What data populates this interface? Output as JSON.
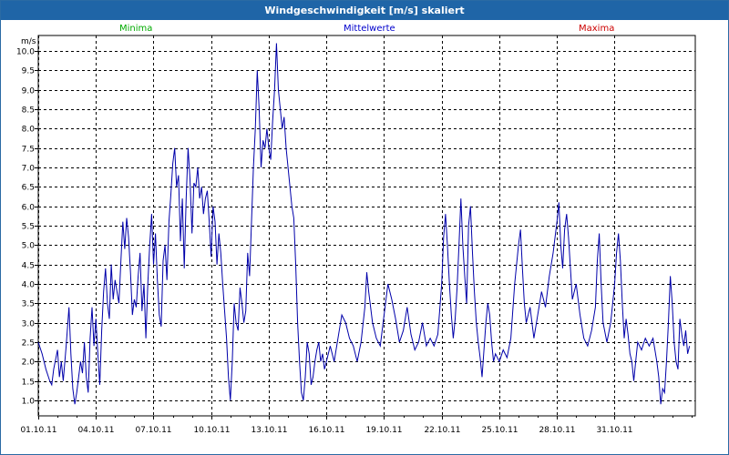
{
  "window": {
    "title": "Windgeschwindigkeit [m/s] skaliert"
  },
  "legend": [
    {
      "label": "Minima",
      "color": "#00aa00"
    },
    {
      "label": "Mittelwerte",
      "color": "#0000cc"
    },
    {
      "label": "Maxima",
      "color": "#cc0000"
    }
  ],
  "chart_data": {
    "type": "line",
    "title": "Windgeschwindigkeit [m/s] skaliert",
    "ylabel": "m/s",
    "xlabel": "",
    "ylim": [
      0.6,
      10.4
    ],
    "yticks": [
      "1.0",
      "1.5",
      "2.0",
      "2.5",
      "3.0",
      "3.5",
      "4.0",
      "4.5",
      "5.0",
      "5.5",
      "6.0",
      "6.5",
      "7.0",
      "7.5",
      "8.0",
      "8.5",
      "9.0",
      "9.5",
      "10.0"
    ],
    "xticks": [
      "01.10.11",
      "04.10.11",
      "07.10.11",
      "10.10.11",
      "13.10.11",
      "16.10.11",
      "19.10.11",
      "22.10.11",
      "25.10.11",
      "28.10.11",
      "31.10.11"
    ],
    "xrange_days": [
      0,
      34.2
    ],
    "grid": true,
    "series": [
      {
        "name": "Mittelwerte",
        "color": "#0000aa",
        "points": [
          [
            0.0,
            2.5
          ],
          [
            0.2,
            2.2
          ],
          [
            0.4,
            1.8
          ],
          [
            0.6,
            1.5
          ],
          [
            0.7,
            1.4
          ],
          [
            0.8,
            1.8
          ],
          [
            1.0,
            2.3
          ],
          [
            1.1,
            1.6
          ],
          [
            1.2,
            2.0
          ],
          [
            1.3,
            1.5
          ],
          [
            1.45,
            2.4
          ],
          [
            1.6,
            3.4
          ],
          [
            1.7,
            2.2
          ],
          [
            1.8,
            1.3
          ],
          [
            1.9,
            0.9
          ],
          [
            2.0,
            1.2
          ],
          [
            2.1,
            1.6
          ],
          [
            2.2,
            2.0
          ],
          [
            2.3,
            1.7
          ],
          [
            2.4,
            2.5
          ],
          [
            2.5,
            1.6
          ],
          [
            2.6,
            1.2
          ],
          [
            2.7,
            2.6
          ],
          [
            2.8,
            3.4
          ],
          [
            2.9,
            2.4
          ],
          [
            3.0,
            3.1
          ],
          [
            3.1,
            2.2
          ],
          [
            3.2,
            1.4
          ],
          [
            3.3,
            2.8
          ],
          [
            3.4,
            3.8
          ],
          [
            3.5,
            4.4
          ],
          [
            3.6,
            3.5
          ],
          [
            3.7,
            3.1
          ],
          [
            3.8,
            4.5
          ],
          [
            3.9,
            3.6
          ],
          [
            4.0,
            4.1
          ],
          [
            4.1,
            3.8
          ],
          [
            4.2,
            3.5
          ],
          [
            4.3,
            4.6
          ],
          [
            4.4,
            5.6
          ],
          [
            4.5,
            4.9
          ],
          [
            4.6,
            5.7
          ],
          [
            4.7,
            5.2
          ],
          [
            4.8,
            4.3
          ],
          [
            4.9,
            3.2
          ],
          [
            5.0,
            3.6
          ],
          [
            5.1,
            3.4
          ],
          [
            5.2,
            4.2
          ],
          [
            5.3,
            4.8
          ],
          [
            5.4,
            3.3
          ],
          [
            5.5,
            4.0
          ],
          [
            5.6,
            2.6
          ],
          [
            5.7,
            4.0
          ],
          [
            5.8,
            5.0
          ],
          [
            5.9,
            5.8
          ],
          [
            6.0,
            4.5
          ],
          [
            6.1,
            5.3
          ],
          [
            6.2,
            4.1
          ],
          [
            6.3,
            3.2
          ],
          [
            6.4,
            2.9
          ],
          [
            6.5,
            4.6
          ],
          [
            6.6,
            5.0
          ],
          [
            6.7,
            4.1
          ],
          [
            6.8,
            5.6
          ],
          [
            6.9,
            6.3
          ],
          [
            7.0,
            7.1
          ],
          [
            7.1,
            7.5
          ],
          [
            7.2,
            6.5
          ],
          [
            7.3,
            6.8
          ],
          [
            7.4,
            5.1
          ],
          [
            7.5,
            6.2
          ],
          [
            7.6,
            4.4
          ],
          [
            7.7,
            6.2
          ],
          [
            7.8,
            7.5
          ],
          [
            7.9,
            6.7
          ],
          [
            8.0,
            5.3
          ],
          [
            8.1,
            6.6
          ],
          [
            8.2,
            6.5
          ],
          [
            8.3,
            7.0
          ],
          [
            8.4,
            6.2
          ],
          [
            8.5,
            6.5
          ],
          [
            8.6,
            5.8
          ],
          [
            8.7,
            6.2
          ],
          [
            8.8,
            6.4
          ],
          [
            8.9,
            5.6
          ],
          [
            9.0,
            4.7
          ],
          [
            9.1,
            6.0
          ],
          [
            9.2,
            5.6
          ],
          [
            9.3,
            4.5
          ],
          [
            9.4,
            5.3
          ],
          [
            9.5,
            4.8
          ],
          [
            9.6,
            4.0
          ],
          [
            9.7,
            3.3
          ],
          [
            9.8,
            2.6
          ],
          [
            9.9,
            1.6
          ],
          [
            10.0,
            1.0
          ],
          [
            10.1,
            2.0
          ],
          [
            10.2,
            3.5
          ],
          [
            10.3,
            3.0
          ],
          [
            10.4,
            2.8
          ],
          [
            10.5,
            3.9
          ],
          [
            10.6,
            3.5
          ],
          [
            10.7,
            3.0
          ],
          [
            10.8,
            3.3
          ],
          [
            10.9,
            4.8
          ],
          [
            11.0,
            4.2
          ],
          [
            11.1,
            5.6
          ],
          [
            11.2,
            7.0
          ],
          [
            11.3,
            8.0
          ],
          [
            11.4,
            9.5
          ],
          [
            11.5,
            8.5
          ],
          [
            11.6,
            7.0
          ],
          [
            11.7,
            7.7
          ],
          [
            11.8,
            7.5
          ],
          [
            11.9,
            8.0
          ],
          [
            12.0,
            7.5
          ],
          [
            12.1,
            7.2
          ],
          [
            12.2,
            8.2
          ],
          [
            12.3,
            9.0
          ],
          [
            12.4,
            10.2
          ],
          [
            12.5,
            9.0
          ],
          [
            12.6,
            8.5
          ],
          [
            12.7,
            8.0
          ],
          [
            12.8,
            8.3
          ],
          [
            12.9,
            7.5
          ],
          [
            13.0,
            7.0
          ],
          [
            13.1,
            6.5
          ],
          [
            13.2,
            6.0
          ],
          [
            13.3,
            5.7
          ],
          [
            13.4,
            4.5
          ],
          [
            13.5,
            3.0
          ],
          [
            13.6,
            2.0
          ],
          [
            13.7,
            1.2
          ],
          [
            13.8,
            1.0
          ],
          [
            13.9,
            1.6
          ],
          [
            14.0,
            2.5
          ],
          [
            14.1,
            2.2
          ],
          [
            14.2,
            1.4
          ],
          [
            14.3,
            1.6
          ],
          [
            14.4,
            2.0
          ],
          [
            14.5,
            2.3
          ],
          [
            14.6,
            2.5
          ],
          [
            14.7,
            2.0
          ],
          [
            14.8,
            2.2
          ],
          [
            14.9,
            1.8
          ],
          [
            15.0,
            2.0
          ],
          [
            15.2,
            2.4
          ],
          [
            15.4,
            2.0
          ],
          [
            15.6,
            2.6
          ],
          [
            15.8,
            3.2
          ],
          [
            16.0,
            3.0
          ],
          [
            16.2,
            2.6
          ],
          [
            16.4,
            2.4
          ],
          [
            16.6,
            2.0
          ],
          [
            16.8,
            2.5
          ],
          [
            17.0,
            3.4
          ],
          [
            17.1,
            4.3
          ],
          [
            17.2,
            3.8
          ],
          [
            17.4,
            3.0
          ],
          [
            17.6,
            2.6
          ],
          [
            17.8,
            2.4
          ],
          [
            18.0,
            3.2
          ],
          [
            18.2,
            4.0
          ],
          [
            18.4,
            3.6
          ],
          [
            18.6,
            3.1
          ],
          [
            18.8,
            2.5
          ],
          [
            19.0,
            2.8
          ],
          [
            19.2,
            3.4
          ],
          [
            19.4,
            2.7
          ],
          [
            19.6,
            2.3
          ],
          [
            19.8,
            2.5
          ],
          [
            20.0,
            3.0
          ],
          [
            20.2,
            2.4
          ],
          [
            20.4,
            2.6
          ],
          [
            20.6,
            2.4
          ],
          [
            20.8,
            2.7
          ],
          [
            21.0,
            4.0
          ],
          [
            21.1,
            5.2
          ],
          [
            21.2,
            5.8
          ],
          [
            21.3,
            5.0
          ],
          [
            21.4,
            4.0
          ],
          [
            21.5,
            3.2
          ],
          [
            21.6,
            2.6
          ],
          [
            21.7,
            3.1
          ],
          [
            21.8,
            3.9
          ],
          [
            21.9,
            5.0
          ],
          [
            22.0,
            6.2
          ],
          [
            22.1,
            5.0
          ],
          [
            22.2,
            4.2
          ],
          [
            22.3,
            3.5
          ],
          [
            22.4,
            5.5
          ],
          [
            22.5,
            6.0
          ],
          [
            22.6,
            4.8
          ],
          [
            22.7,
            3.8
          ],
          [
            22.8,
            3.0
          ],
          [
            22.9,
            2.5
          ],
          [
            23.0,
            2.1
          ],
          [
            23.1,
            1.6
          ],
          [
            23.2,
            2.3
          ],
          [
            23.3,
            3.0
          ],
          [
            23.4,
            3.5
          ],
          [
            23.5,
            3.2
          ],
          [
            23.6,
            2.5
          ],
          [
            23.7,
            2.0
          ],
          [
            23.8,
            2.2
          ],
          [
            24.0,
            2.0
          ],
          [
            24.2,
            2.3
          ],
          [
            24.4,
            2.1
          ],
          [
            24.6,
            2.6
          ],
          [
            24.8,
            4.0
          ],
          [
            25.0,
            5.0
          ],
          [
            25.1,
            5.4
          ],
          [
            25.2,
            4.4
          ],
          [
            25.3,
            3.5
          ],
          [
            25.4,
            3.0
          ],
          [
            25.6,
            3.4
          ],
          [
            25.8,
            2.6
          ],
          [
            26.0,
            3.2
          ],
          [
            26.2,
            3.8
          ],
          [
            26.4,
            3.4
          ],
          [
            26.6,
            4.2
          ],
          [
            26.8,
            4.8
          ],
          [
            27.0,
            5.6
          ],
          [
            27.1,
            6.1
          ],
          [
            27.2,
            5.0
          ],
          [
            27.3,
            4.4
          ],
          [
            27.4,
            5.4
          ],
          [
            27.5,
            5.8
          ],
          [
            27.6,
            5.2
          ],
          [
            27.7,
            4.4
          ],
          [
            27.8,
            3.6
          ],
          [
            28.0,
            4.0
          ],
          [
            28.2,
            3.2
          ],
          [
            28.4,
            2.6
          ],
          [
            28.6,
            2.4
          ],
          [
            28.8,
            2.8
          ],
          [
            29.0,
            3.4
          ],
          [
            29.1,
            4.6
          ],
          [
            29.2,
            5.3
          ],
          [
            29.3,
            4.0
          ],
          [
            29.4,
            3.0
          ],
          [
            29.6,
            2.5
          ],
          [
            29.8,
            3.0
          ],
          [
            30.0,
            4.0
          ],
          [
            30.1,
            4.8
          ],
          [
            30.2,
            5.3
          ],
          [
            30.3,
            4.6
          ],
          [
            30.4,
            3.5
          ],
          [
            30.5,
            2.6
          ],
          [
            30.6,
            3.1
          ],
          [
            30.7,
            2.7
          ],
          [
            30.8,
            2.2
          ],
          [
            30.9,
            2.0
          ],
          [
            31.0,
            1.5
          ],
          [
            31.1,
            2.0
          ],
          [
            31.2,
            2.5
          ],
          [
            31.4,
            2.3
          ],
          [
            31.6,
            2.6
          ],
          [
            31.8,
            2.4
          ],
          [
            32.0,
            2.6
          ],
          [
            32.2,
            2.0
          ],
          [
            32.3,
            1.6
          ],
          [
            32.4,
            0.9
          ],
          [
            32.5,
            1.3
          ],
          [
            32.6,
            1.2
          ],
          [
            32.7,
            2.0
          ],
          [
            32.8,
            3.0
          ],
          [
            32.9,
            4.2
          ],
          [
            33.0,
            3.5
          ],
          [
            33.1,
            2.5
          ],
          [
            33.2,
            2.0
          ],
          [
            33.3,
            1.8
          ],
          [
            33.4,
            3.1
          ],
          [
            33.5,
            2.7
          ],
          [
            33.6,
            2.4
          ],
          [
            33.7,
            2.8
          ],
          [
            33.8,
            2.2
          ],
          [
            33.9,
            2.4
          ]
        ]
      }
    ]
  }
}
